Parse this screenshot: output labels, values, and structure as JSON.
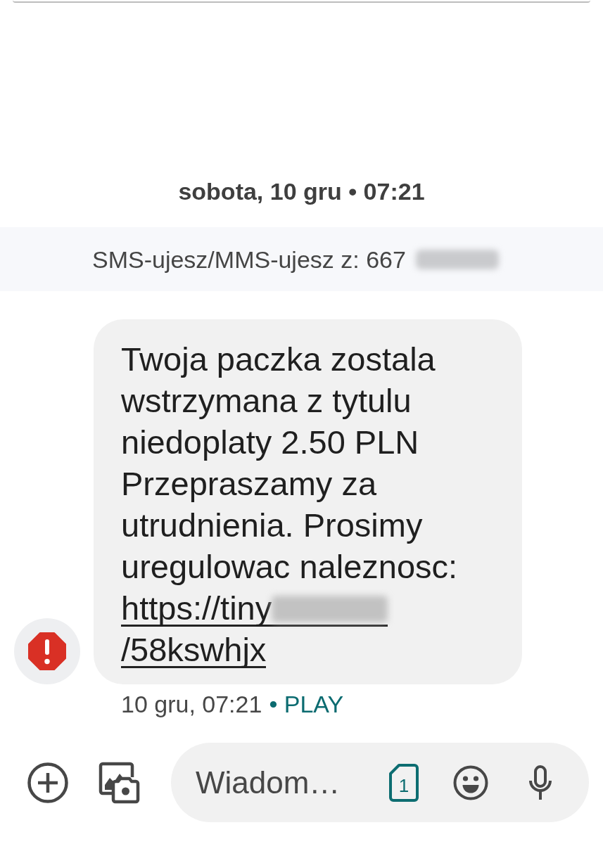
{
  "date_header": "sobota, 10 gru • 07:21",
  "sender_notice": {
    "text": "SMS-ujesz/MMS-ujesz z: 667",
    "number_blurred": true
  },
  "messages": [
    {
      "incoming": true,
      "failed": true,
      "text": "Twoja paczka zostala wstrzymana z tytulu niedoplaty 2.50 PLN Przepraszamy za utrudnienia. Prosimy uregulowac naleznosc:",
      "link": {
        "before_blur": "https://tiny",
        "after_blur": "/58kswhjx"
      },
      "time": "10 gru, 07:21",
      "carrier": "• PLAY"
    }
  ],
  "compose": {
    "placeholder": "Wiadom…",
    "sim": "1"
  }
}
